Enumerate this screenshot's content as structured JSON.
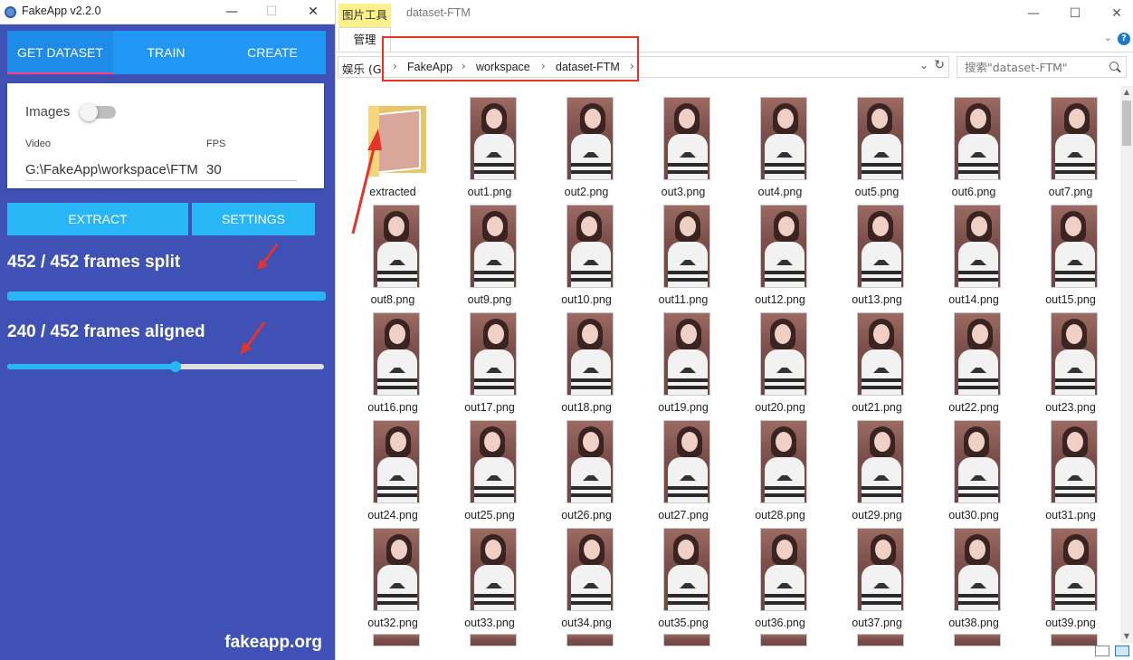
{
  "fakeapp": {
    "title": "FakeApp v2.2.0",
    "window_controls": {
      "minimize": "—",
      "maximize": "☐",
      "close": "✕"
    },
    "tabs": [
      {
        "label": "GET DATASET",
        "active": true
      },
      {
        "label": "TRAIN",
        "active": false
      },
      {
        "label": "CREATE",
        "active": false
      }
    ],
    "card": {
      "images_label": "Images",
      "images_toggle_on": false,
      "video_label": "Video",
      "fps_label": "FPS",
      "video_value": "G:\\FakeApp\\workspace\\FTM",
      "fps_value": "30"
    },
    "buttons": {
      "extract": "EXTRACT",
      "settings": "SETTINGS"
    },
    "progress": {
      "split_text": "452 / 452 frames split",
      "split_fraction": 1.0,
      "aligned_text": "240 / 452 frames aligned",
      "aligned_fraction": 0.531
    },
    "footer": "fakeapp.org",
    "colors": {
      "primary": "#3f51b5",
      "tab_bar": "#2196f3",
      "accent": "#29b6f6",
      "indicator": "#ff4081",
      "annotation": "#e5332a"
    }
  },
  "explorer": {
    "context_tab": "图片工具",
    "window_title": "dataset-FTM",
    "manage_tab": "管理",
    "window_controls": {
      "minimize": "—",
      "maximize": "☐",
      "close": "✕"
    },
    "address": {
      "root_label": "娱乐 (G:",
      "crumbs": [
        "FakeApp",
        "workspace",
        "dataset-FTM"
      ]
    },
    "search_placeholder": "搜索\"dataset-FTM\"",
    "items": [
      "extracted",
      "out1.png",
      "out2.png",
      "out3.png",
      "out4.png",
      "out5.png",
      "out6.png",
      "out7.png",
      "out8.png",
      "out9.png",
      "out10.png",
      "out11.png",
      "out12.png",
      "out13.png",
      "out14.png",
      "out15.png",
      "out16.png",
      "out17.png",
      "out18.png",
      "out19.png",
      "out20.png",
      "out21.png",
      "out22.png",
      "out23.png",
      "out24.png",
      "out25.png",
      "out26.png",
      "out27.png",
      "out28.png",
      "out29.png",
      "out30.png",
      "out31.png",
      "out32.png",
      "out33.png",
      "out34.png",
      "out35.png",
      "out36.png",
      "out37.png",
      "out38.png",
      "out39.png"
    ],
    "icons": [
      "folder-icon",
      "image-thumbnail-icon",
      "search-icon",
      "refresh-icon",
      "help-icon"
    ]
  }
}
